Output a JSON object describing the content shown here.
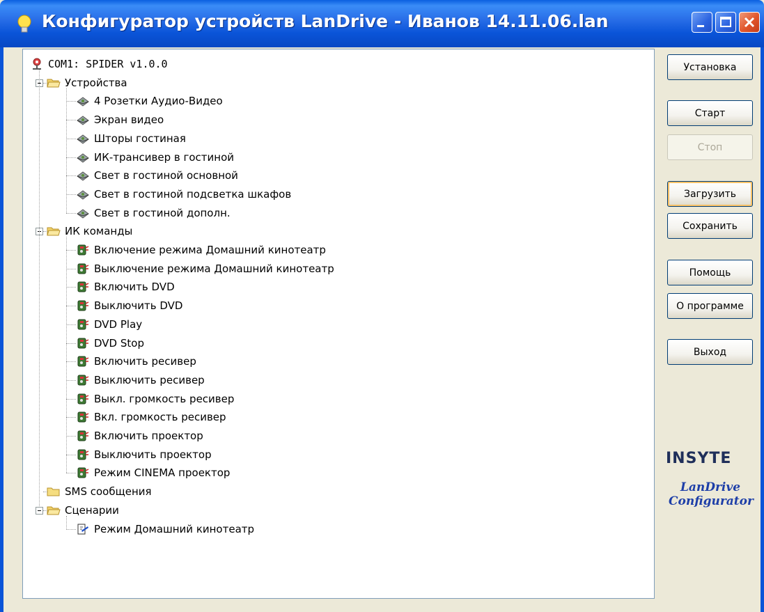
{
  "window": {
    "title": "Конфигуратор устройств LanDrive - Иванов 14.11.06.lan"
  },
  "tree": {
    "root": {
      "label": "COM1: SPIDER v1.0.0",
      "icon": "network-icon"
    },
    "groups": [
      {
        "label": "Устройства",
        "icon": "folder-open-icon",
        "expanded": true,
        "items": [
          {
            "label": "4 Розетки Аудио-Видео",
            "icon": "device-icon"
          },
          {
            "label": "Экран видео",
            "icon": "device-icon"
          },
          {
            "label": "Шторы гостиная",
            "icon": "device-icon"
          },
          {
            "label": "ИК-трансивер в гостиной",
            "icon": "device-icon"
          },
          {
            "label": "Свет в гостиной основной",
            "icon": "device-icon"
          },
          {
            "label": "Свет в гостиной подсветка шкафов",
            "icon": "device-icon"
          },
          {
            "label": "Свет в гостиной дополн.",
            "icon": "device-icon"
          }
        ]
      },
      {
        "label": "ИК команды",
        "icon": "folder-open-icon",
        "expanded": true,
        "items": [
          {
            "label": "Включение режима Домашний кинотеатр",
            "icon": "ir-command-icon"
          },
          {
            "label": "Выключение режима Домашний кинотеатр",
            "icon": "ir-command-icon"
          },
          {
            "label": "Включить DVD",
            "icon": "ir-command-icon"
          },
          {
            "label": "Выключить DVD",
            "icon": "ir-command-icon"
          },
          {
            "label": "DVD Play",
            "icon": "ir-command-icon"
          },
          {
            "label": "DVD Stop",
            "icon": "ir-command-icon"
          },
          {
            "label": "Включить ресивер",
            "icon": "ir-command-icon"
          },
          {
            "label": "Выключить ресивер",
            "icon": "ir-command-icon"
          },
          {
            "label": "Выкл. громкость ресивер",
            "icon": "ir-command-icon"
          },
          {
            "label": "Вкл. громкость ресивер",
            "icon": "ir-command-icon"
          },
          {
            "label": "Включить проектор",
            "icon": "ir-command-icon"
          },
          {
            "label": "Выключить проектор",
            "icon": "ir-command-icon"
          },
          {
            "label": "Режим CINEMA проектор",
            "icon": "ir-command-icon"
          }
        ]
      },
      {
        "label": "SMS сообщения",
        "icon": "folder-icon",
        "expanded": false,
        "items": []
      },
      {
        "label": "Сценарии",
        "icon": "folder-open-icon",
        "expanded": true,
        "items": [
          {
            "label": "Режим Домашний кинотеатр",
            "icon": "scenario-icon"
          }
        ]
      }
    ]
  },
  "buttons": {
    "install": "Установка",
    "start": "Старт",
    "stop": "Стоп",
    "load": "Загрузить",
    "save": "Сохранить",
    "help": "Помощь",
    "about": "О программе",
    "exit": "Выход"
  },
  "branding": {
    "company": "INSYTE",
    "product_line1": "LanDrive",
    "product_line2": "Configurator"
  },
  "colors": {
    "titlebar": "#0a54d8",
    "window_bg": "#ece9d8",
    "logo_blue": "#1e3fa8"
  }
}
